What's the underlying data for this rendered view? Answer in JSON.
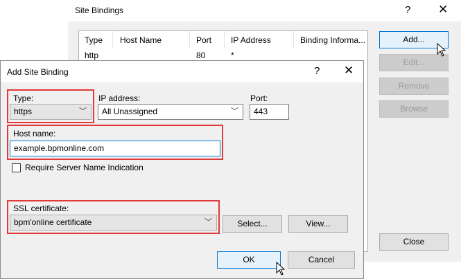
{
  "site_bindings": {
    "title": "Site Bindings",
    "help_glyph": "?",
    "close_glyph": "✕",
    "columns": [
      "Type",
      "Host Name",
      "Port",
      "IP Address",
      "Binding Informa..."
    ],
    "rows": [
      {
        "type": "http",
        "host": "",
        "port": "80",
        "ip": "*",
        "info": ""
      }
    ],
    "buttons": {
      "add": "Add...",
      "edit": "Edit...",
      "remove": "Remove",
      "browse": "Browse",
      "close": "Close"
    }
  },
  "dialog": {
    "title": "Add Site Binding",
    "help_glyph": "?",
    "close_glyph": "✕",
    "type_label": "Type:",
    "type_value": "https",
    "ip_label": "IP address:",
    "ip_value": "All Unassigned",
    "port_label": "Port:",
    "port_value": "443",
    "host_label": "Host name:",
    "host_value": "example.bpmonline.com",
    "sni_label": "Require Server Name Indication",
    "sni_checked": false,
    "ssl_label": "SSL certificate:",
    "ssl_value": "bpm'online certificate",
    "select_button": "Select...",
    "view_button": "View...",
    "ok_button": "OK",
    "cancel_button": "Cancel"
  },
  "colors": {
    "highlight": "#e03a3a",
    "accent": "#0078d7",
    "window_bg": "#f0f0f0"
  },
  "icons": [
    "chevron-down-icon",
    "cursor-arrow-icon",
    "close-icon",
    "help-icon",
    "checkbox-icon"
  ]
}
